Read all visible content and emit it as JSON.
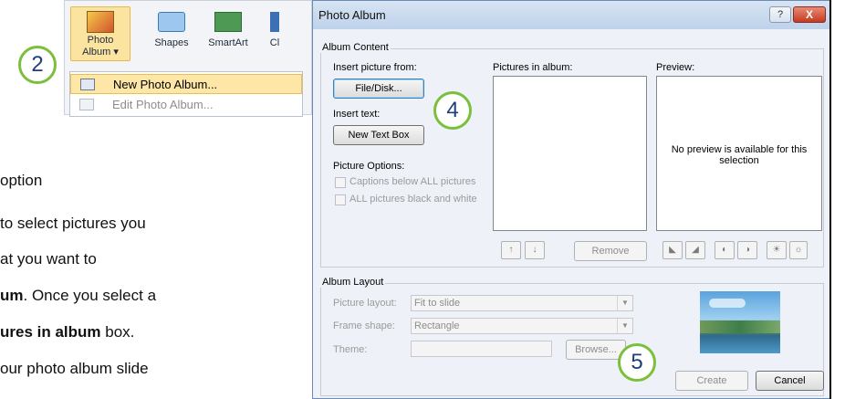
{
  "ribbon": {
    "photo_album_label": "Photo",
    "photo_album_label2": "Album",
    "shapes_label": "Shapes",
    "smartart_label": "SmartArt",
    "clipped_label": "Cl",
    "menu": {
      "new_photo_album": "New Photo Album...",
      "edit_photo_album": "Edit Photo Album..."
    }
  },
  "callouts": {
    "c2": "2",
    "c4": "4",
    "c5": "5"
  },
  "body_text": {
    "line1": "option",
    "line2": "to select pictures you",
    "line3": "at you want to",
    "line4_bold": "um",
    "line4_rest": ". Once you select a",
    "line5_bold": "ures in album",
    "line5_rest": " box.",
    "line6": "our photo album slide"
  },
  "dialog": {
    "title": "Photo Album",
    "help": "?",
    "close": "X",
    "album_content": {
      "group_label": "Album Content",
      "insert_picture_from": "Insert picture from:",
      "file_disk_button": "File/Disk...",
      "insert_text": "Insert text:",
      "new_text_box_button": "New Text Box",
      "picture_options": "Picture Options:",
      "captions_checkbox": "Captions below ALL pictures",
      "black_white_checkbox": "ALL pictures black and white",
      "pictures_in_album": "Pictures in album:",
      "preview": "Preview:",
      "preview_message": "No preview is available for this selection",
      "remove_button": "Remove",
      "move_up": "↑",
      "move_down": "↓"
    },
    "album_layout": {
      "group_label": "Album Layout",
      "picture_layout_label": "Picture layout:",
      "picture_layout_value": "Fit to slide",
      "frame_shape_label": "Frame shape:",
      "frame_shape_value": "Rectangle",
      "theme_label": "Theme:",
      "theme_value": "",
      "browse_button": "Browse..."
    },
    "create_button": "Create",
    "cancel_button": "Cancel"
  }
}
